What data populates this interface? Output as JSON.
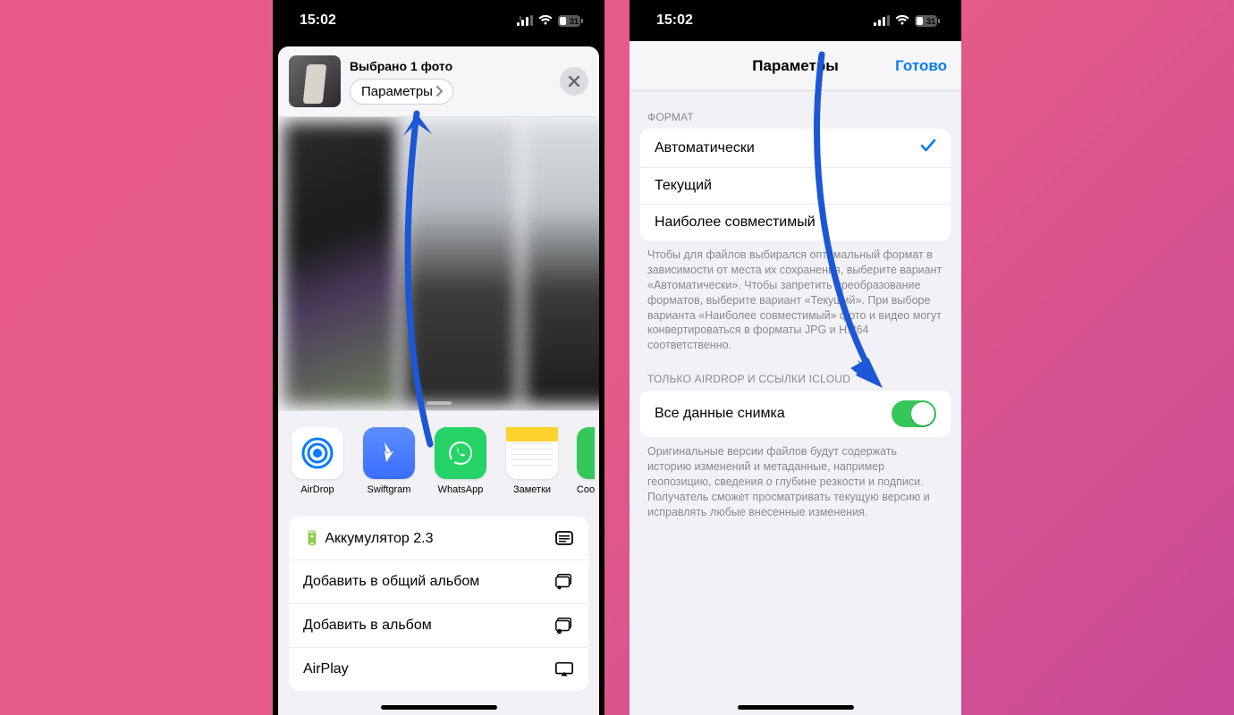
{
  "status": {
    "time": "15:02",
    "battery": "31"
  },
  "share": {
    "selected_title": "Выбрано 1 фото",
    "params_button": "Параметры",
    "apps": [
      {
        "label": "AirDrop"
      },
      {
        "label": "Swiftgram"
      },
      {
        "label": "WhatsApp"
      },
      {
        "label": "Заметки"
      },
      {
        "label": "Соо"
      }
    ],
    "actions": [
      {
        "label": "🔋 Аккумулятор 2.3"
      },
      {
        "label": "Добавить в общий альбом"
      },
      {
        "label": "Добавить в альбом"
      },
      {
        "label": "AirPlay"
      }
    ]
  },
  "params": {
    "nav_title": "Параметры",
    "done": "Готово",
    "format_header": "ФОРМАТ",
    "format_options": {
      "auto": "Автоматически",
      "current": "Текущий",
      "compat": "Наиболее совместимый"
    },
    "format_footer": "Чтобы для файлов выбирался оптимальный формат в зависимости от места их сохранения, выберите вариант «Автоматически». Чтобы запретить преобразование форматов, выберите вариант «Текущий». При выборе варианта «Наиболее совместимый» фото и видео могут конвертироваться в форматы JPG и H.264 соответственно.",
    "airdrop_header": "ТОЛЬКО AIRDROP И ССЫЛКИ ICLOUD",
    "all_data_label": "Все данные снимка",
    "airdrop_footer": "Оригинальные версии файлов будут содержать историю изменений и метаданные, например геопозицию, сведения о глубине резкости и подписи. Получатель сможет просматривать текущую версию и исправлять любые внесенные изменения."
  }
}
